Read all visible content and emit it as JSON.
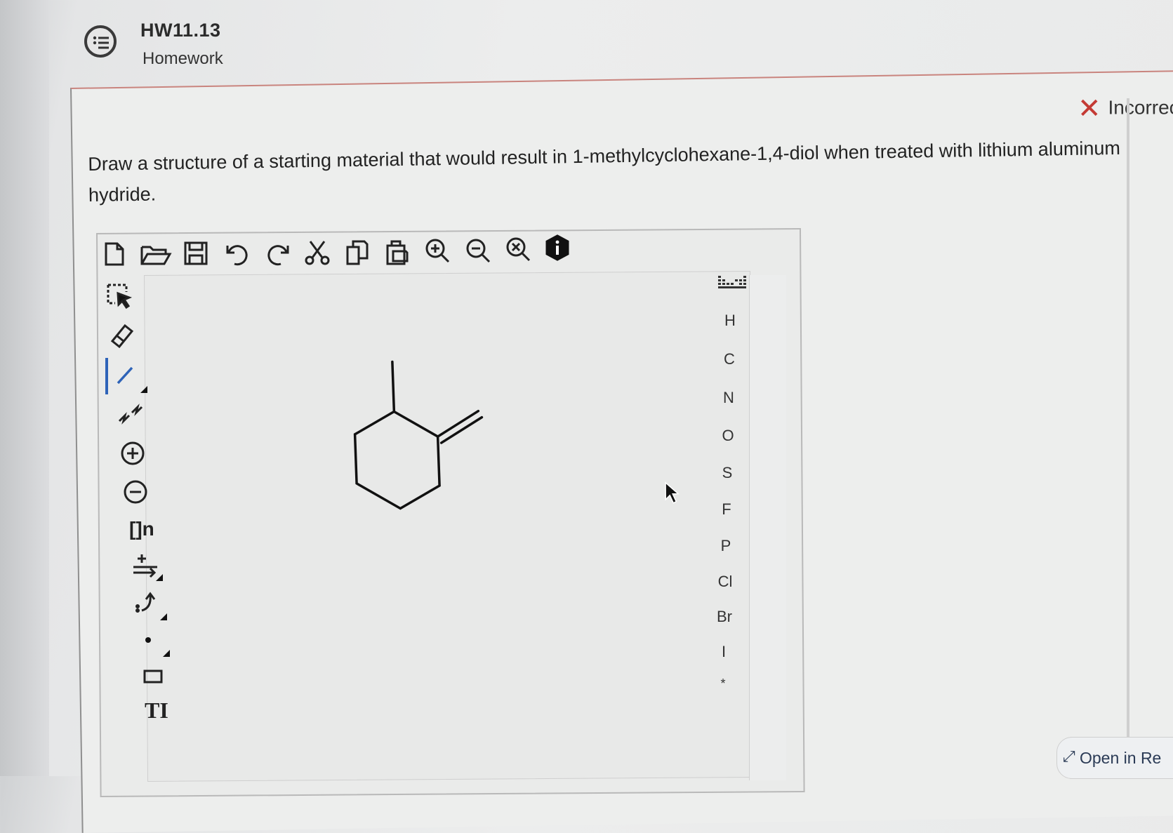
{
  "header": {
    "title": "HW11.13",
    "subtitle": "Homework",
    "icon": "list-bubble-icon"
  },
  "status": {
    "label": "Incorrec",
    "color": "#c43a34"
  },
  "question": {
    "text": "Draw a structure of a starting material that would result in 1-methylcyclohexane-1,4-diol when treated with lithium aluminum hydride."
  },
  "toolbar": {
    "top": [
      "new-document-icon",
      "open-folder-icon",
      "save-icon",
      "undo-icon",
      "redo-icon",
      "cut-icon",
      "copy-icon",
      "paste-icon",
      "zoom-in-icon",
      "zoom-out-icon",
      "zoom-reset-icon",
      "info-icon"
    ],
    "left": [
      "select-tool-icon",
      "eraser-icon",
      "bond-tool-icon",
      "chain-tool-icon",
      "charge-plus-icon",
      "charge-minus-icon",
      "bracket-tool-icon",
      "reaction-arrow-icon",
      "electron-arrow-icon",
      "radical-dot-icon",
      "rectangle-tool-icon",
      "text-tool-icon"
    ],
    "bracket_label": "[]n",
    "text_tool_label": "TI"
  },
  "elements": [
    "H",
    "C",
    "N",
    "O",
    "S",
    "F",
    "P",
    "Cl",
    "Br",
    "I",
    "*"
  ],
  "footer": {
    "open_label": "Open in Re"
  }
}
